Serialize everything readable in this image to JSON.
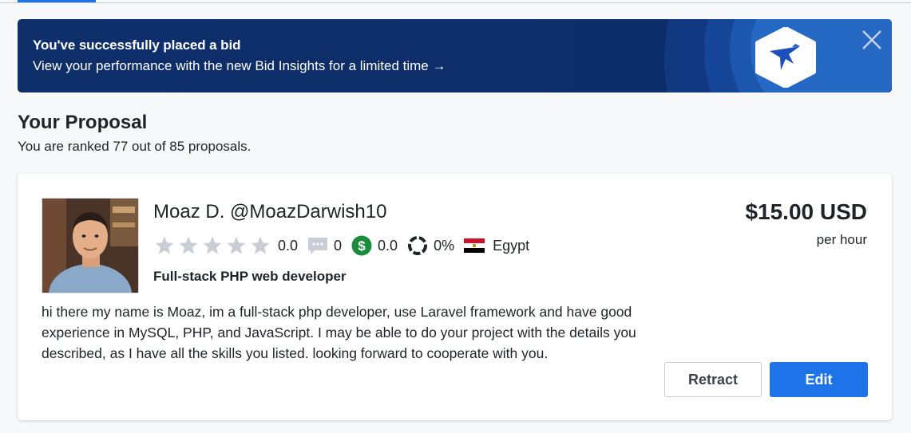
{
  "banner": {
    "title": "You've successfully placed a bid",
    "link_text": "View your performance with the new Bid Insights for a limited time →",
    "logo_icon": "freelancer-bird-logo",
    "close_icon": "close-icon"
  },
  "proposal_section": {
    "title": "Your Proposal",
    "ranked_text": "You are ranked 77 out of 85 proposals."
  },
  "bid": {
    "name_line": "Moaz D. @MoazDarwish10",
    "rating": "0.0",
    "star_count": 5,
    "reviews": "0",
    "earnings_score": "0.0",
    "completion_rate": "0%",
    "country": "Egypt",
    "headline": "Full-stack PHP web developer",
    "description": "hi there my name is Moaz, im a full-stack php developer, use Laravel framework and have good experience in MySQL, PHP, and JavaScript. I may be able to do your project with the details you described, as I have all the skills you listed. looking forward to cooperate with you.",
    "price": "$15.00 USD",
    "price_unit": "per hour"
  },
  "buttons": {
    "retract_label": "Retract",
    "edit_label": "Edit"
  },
  "colors": {
    "accent": "#1f73e8",
    "banner_bg": "#0d2e6a",
    "star_gray": "#c8cdd6",
    "earnings_green": "#1a8c3c"
  }
}
